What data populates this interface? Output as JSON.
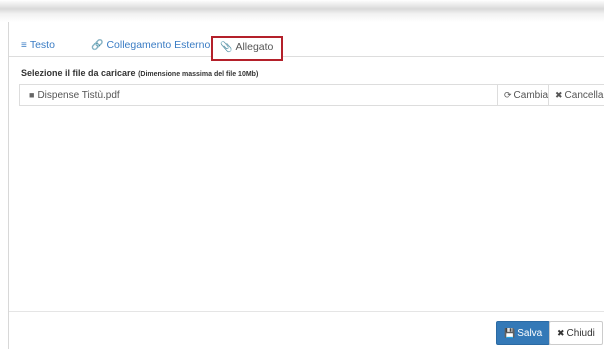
{
  "tabs": [
    {
      "label": "Testo",
      "icon": "align-left-icon",
      "glyph": "≡"
    },
    {
      "label": "Collegamento Esterno",
      "icon": "link-icon",
      "glyph": "🔗"
    },
    {
      "label": "Allegato",
      "icon": "paperclip-icon",
      "glyph": "📎"
    }
  ],
  "active_tab": "Allegato",
  "active_tab_highlight_color": "#b4202a",
  "upload": {
    "label": "Selezione il file da caricare",
    "hint": "(Dimensione massima del file 10Mb)",
    "file_name": "Dispense Tistù.pdf",
    "file_icon": "file-icon",
    "change_label": "Cambia",
    "change_icon": "refresh-icon",
    "remove_label": "Cancella",
    "remove_icon": "close-icon"
  },
  "footer": {
    "save_label": "Salva",
    "save_icon": "save-icon",
    "close_label": "Chiudi",
    "close_icon": "close-icon",
    "primary_color": "#3479b7"
  }
}
